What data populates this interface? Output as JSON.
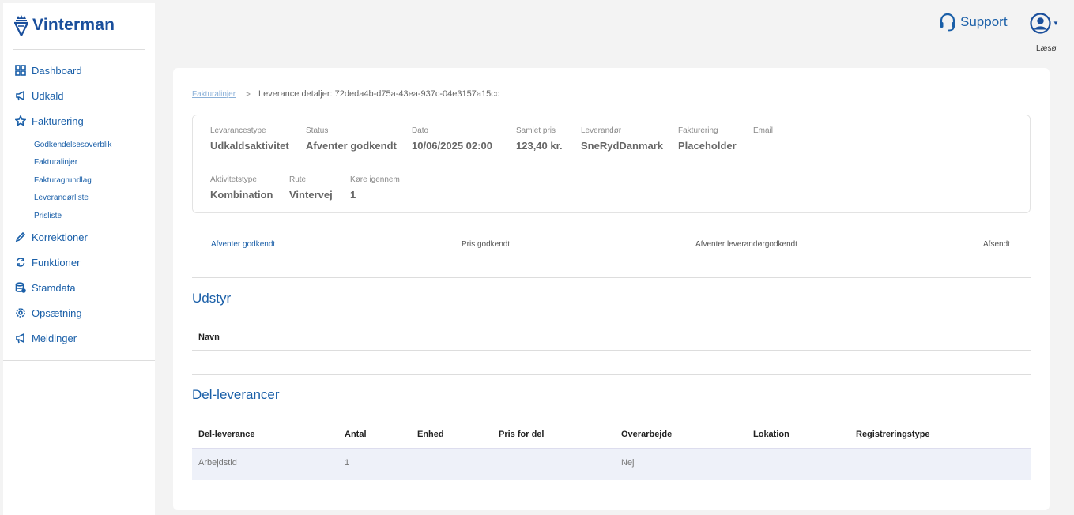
{
  "app": {
    "logo_text": "Vinterman"
  },
  "sidebar": {
    "items": [
      {
        "label": "Dashboard",
        "icon": "dashboard-icon"
      },
      {
        "label": "Udkald",
        "icon": "megaphone-icon"
      },
      {
        "label": "Fakturering",
        "icon": "star-icon"
      },
      {
        "label": "Korrektioner",
        "icon": "pencil-icon"
      },
      {
        "label": "Funktioner",
        "icon": "refresh-icon"
      },
      {
        "label": "Stamdata",
        "icon": "database-icon"
      },
      {
        "label": "Opsætning",
        "icon": "gear-icon"
      },
      {
        "label": "Meldinger",
        "icon": "megaphone-icon"
      }
    ],
    "subitems": [
      "Godkendelsesoverblik",
      "Fakturalinjer",
      "Fakturagrundlag",
      "Leverandørliste",
      "Prisliste"
    ]
  },
  "header": {
    "support_label": "Support",
    "user_name": "Læsø"
  },
  "breadcrumb": {
    "link": "Fakturalinjer",
    "current": "Leverance detaljer: 72deda4b-d75a-43ea-937c-04e3157a15cc"
  },
  "details": {
    "row1": [
      {
        "label": "Levarancestype",
        "value": "Udkaldsaktivitet"
      },
      {
        "label": "Status",
        "value": "Afventer godkendt"
      },
      {
        "label": "Dato",
        "value": "10/06/2025 02:00"
      },
      {
        "label": "Samlet pris",
        "value": "123,40 kr."
      },
      {
        "label": "Leverandør",
        "value": "SneRydDanmark"
      },
      {
        "label": "Fakturering",
        "value": "Placeholder"
      },
      {
        "label": "Email",
        "value": ""
      }
    ],
    "row2": [
      {
        "label": "Aktivitetstype",
        "value": "Kombination"
      },
      {
        "label": "Rute",
        "value": "Vintervej"
      },
      {
        "label": "Køre igennem",
        "value": "1"
      }
    ]
  },
  "steps": [
    "Afventer godkendt",
    "Pris godkendt",
    "Afventer leverandørgodkendt",
    "Afsendt"
  ],
  "active_step": 0,
  "udstyr": {
    "title": "Udstyr",
    "columns": [
      "Navn"
    ]
  },
  "del_leverancer": {
    "title": "Del-leverancer",
    "columns": [
      "Del-leverance",
      "Antal",
      "Enhed",
      "Pris for del",
      "Overarbejde",
      "Lokation",
      "Registreringstype"
    ],
    "rows": [
      [
        "Arbejdstid",
        "1",
        "",
        "",
        "Nej",
        "",
        ""
      ]
    ]
  },
  "colors": {
    "accent": "#1a5fa8",
    "brand": "#1a4f9c",
    "row_bg": "#eef1f9"
  }
}
